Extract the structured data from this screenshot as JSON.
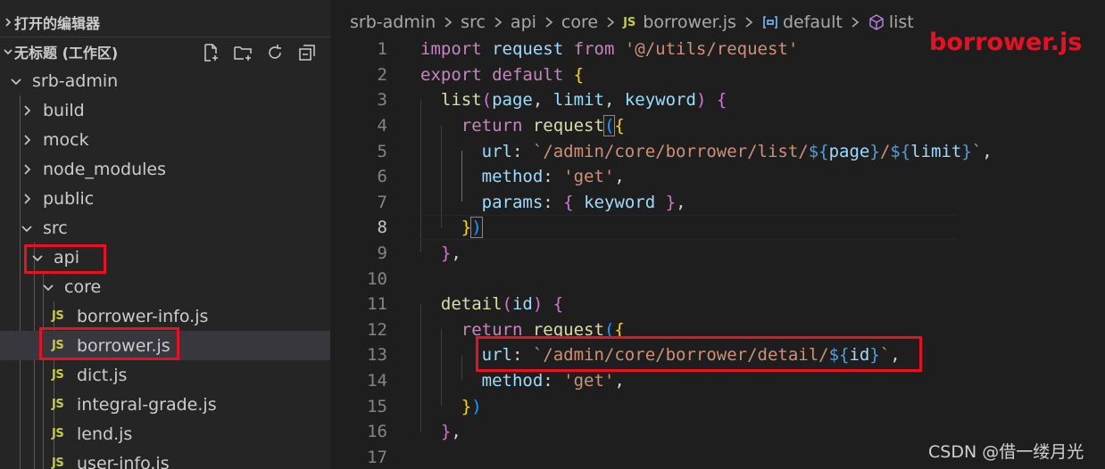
{
  "sidebar": {
    "open_editors_label": "打开的编辑器",
    "workspace_label": "无标题 (工作区)",
    "workspace_actions": [
      "new-file-icon",
      "new-folder-icon",
      "refresh-icon",
      "collapse-all-icon"
    ],
    "tree": [
      {
        "label": "srb-admin",
        "type": "folder",
        "expanded": true
      },
      {
        "label": "build",
        "type": "folder",
        "expanded": false
      },
      {
        "label": "mock",
        "type": "folder",
        "expanded": false
      },
      {
        "label": "node_modules",
        "type": "folder",
        "expanded": false
      },
      {
        "label": "public",
        "type": "folder",
        "expanded": false
      },
      {
        "label": "src",
        "type": "folder",
        "expanded": true
      },
      {
        "label": "api",
        "type": "folder",
        "expanded": true
      },
      {
        "label": "core",
        "type": "folder",
        "expanded": true
      },
      {
        "label": "borrower-info.js",
        "type": "file",
        "badge": "JS"
      },
      {
        "label": "borrower.js",
        "type": "file",
        "badge": "JS",
        "selected": true
      },
      {
        "label": "dict.js",
        "type": "file",
        "badge": "JS"
      },
      {
        "label": "integral-grade.js",
        "type": "file",
        "badge": "JS"
      },
      {
        "label": "lend.js",
        "type": "file",
        "badge": "JS"
      },
      {
        "label": "user-info.js",
        "type": "file",
        "badge": "JS"
      }
    ]
  },
  "breadcrumb": {
    "items": [
      "srb-admin",
      "src",
      "api",
      "core"
    ],
    "file_badge": "JS",
    "file": "borrower.js",
    "symbol1": "default",
    "symbol2": "list"
  },
  "editor": {
    "current_line": 8,
    "line_numbers": [
      "1",
      "2",
      "3",
      "4",
      "5",
      "6",
      "7",
      "8",
      "9",
      "10",
      "11",
      "12",
      "13",
      "14",
      "15",
      "16",
      "17"
    ]
  },
  "annotation": "borrower.js",
  "watermark": "CSDN @借一缕月光",
  "colors": {
    "highlight_box": "#e81123",
    "keyword": "#c586c0",
    "function": "#dcdcaa",
    "variable": "#9cdcfe",
    "string": "#ce9178",
    "js_badge": "#cbcb41"
  }
}
